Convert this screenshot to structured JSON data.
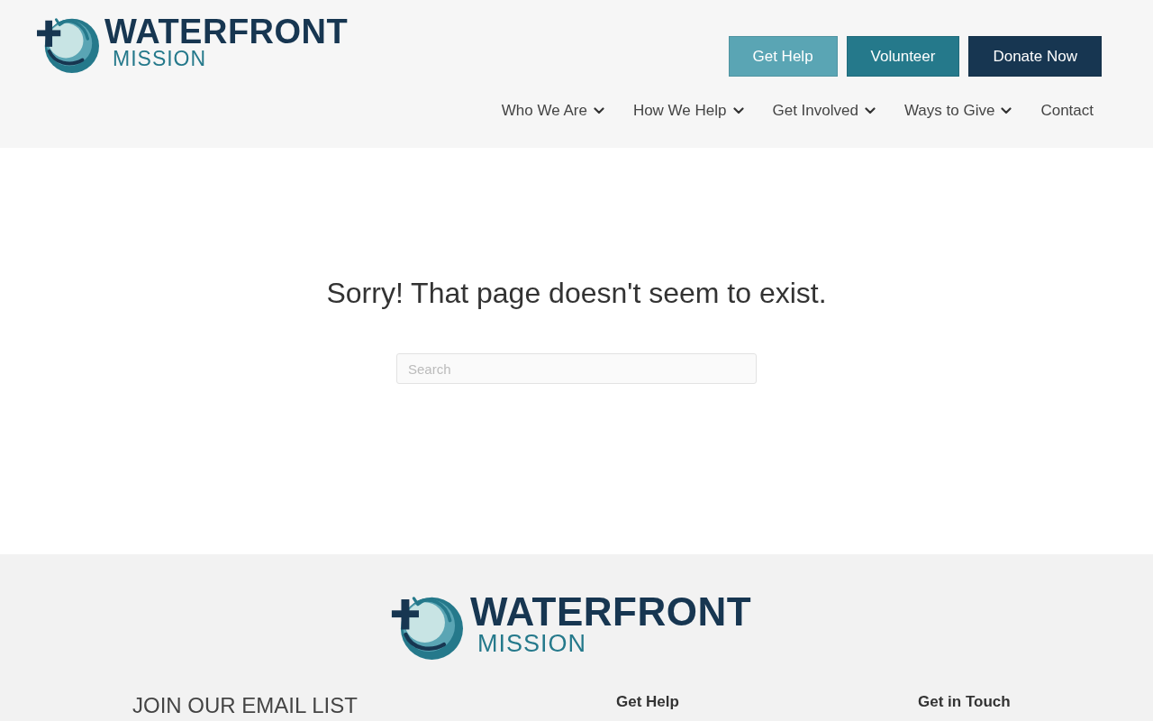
{
  "header": {
    "logo": {
      "name": "WATERFRONT",
      "tagline": "MISSION"
    },
    "buttons": [
      {
        "label": "Get Help",
        "color": "#5aa5b4"
      },
      {
        "label": "Volunteer",
        "color": "#25798b"
      },
      {
        "label": "Donate Now",
        "color": "#173651"
      }
    ],
    "nav": [
      {
        "label": "Who We Are",
        "has_menu": true
      },
      {
        "label": "How We Help",
        "has_menu": true
      },
      {
        "label": "Get Involved",
        "has_menu": true
      },
      {
        "label": "Ways to Give",
        "has_menu": true
      },
      {
        "label": "Contact",
        "has_menu": false
      }
    ]
  },
  "main": {
    "heading": "Sorry! That page doesn't seem to exist.",
    "search": {
      "placeholder": "Search"
    }
  },
  "footer": {
    "logo": {
      "name": "WATERFRONT",
      "tagline": "MISSION"
    },
    "columns": [
      {
        "heading": "JOIN OUR EMAIL LIST",
        "kind": "light"
      },
      {
        "heading": "Get Help",
        "kind": "bold"
      },
      {
        "heading": "Get in Touch",
        "kind": "bold"
      }
    ]
  }
}
